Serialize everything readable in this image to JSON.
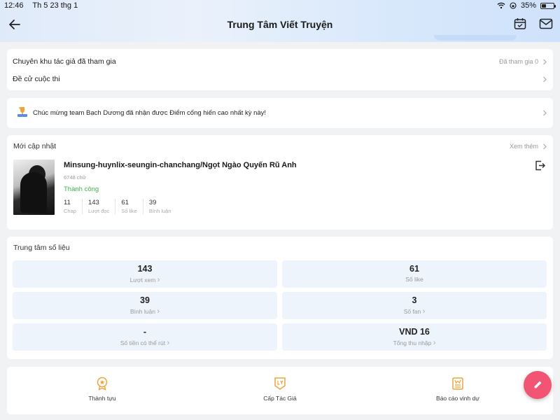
{
  "status_bar": {
    "time": "12:46",
    "date": "Th 5 23 thg 1",
    "battery": "35%",
    "battery_level": 0.35
  },
  "header": {
    "title": "Trung Tâm Viết Truyện"
  },
  "list_card": {
    "items": [
      {
        "label": "Chuyên khu tác giả đã tham gia",
        "meta": "Đã tham gia 0"
      },
      {
        "label": "Đề cử cuộc thi",
        "meta": ""
      }
    ]
  },
  "announcement": {
    "text": "Chúc mừng team Bạch Dương đã nhận được Điểm cống hiến cao nhất kỳ này!",
    "icon": "trophy-icon"
  },
  "recent": {
    "title": "Mới cập nhật",
    "more": "Xem thêm",
    "book": {
      "title": "Minsung-huynlix-seungin-chanchang/Ngọt Ngào Quyến Rũ Anh",
      "words": "6748 chữ",
      "status": "Thành công",
      "stats": [
        {
          "value": "11",
          "label": "Chap"
        },
        {
          "value": "143",
          "label": "Lượt đọc"
        },
        {
          "value": "61",
          "label": "Số like"
        },
        {
          "value": "39",
          "label": "Bình luận"
        }
      ]
    }
  },
  "data_center": {
    "title": "Trung tâm số liệu",
    "tiles": [
      {
        "value": "143",
        "label": "Lượt xem"
      },
      {
        "value": "61",
        "label": "Số like"
      },
      {
        "value": "39",
        "label": "Bình luận"
      },
      {
        "value": "3",
        "label": "Số fan"
      },
      {
        "value": "-",
        "label": "Số tiền có thể rút"
      },
      {
        "value": "VND 16",
        "label": "Tổng thu nhập"
      }
    ]
  },
  "tools": [
    {
      "label": "Thành tựu",
      "icon": "medal-icon"
    },
    {
      "label": "Cấp Tác Giả",
      "icon": "level-badge-icon"
    },
    {
      "label": "Báo cáo vinh dự",
      "icon": "honor-report-icon"
    }
  ],
  "colors": {
    "accent_orange": "#f0a23a",
    "success_green": "#3bb54a",
    "fab_pink": "#f25473",
    "tile_bg": "#eef4fc"
  }
}
